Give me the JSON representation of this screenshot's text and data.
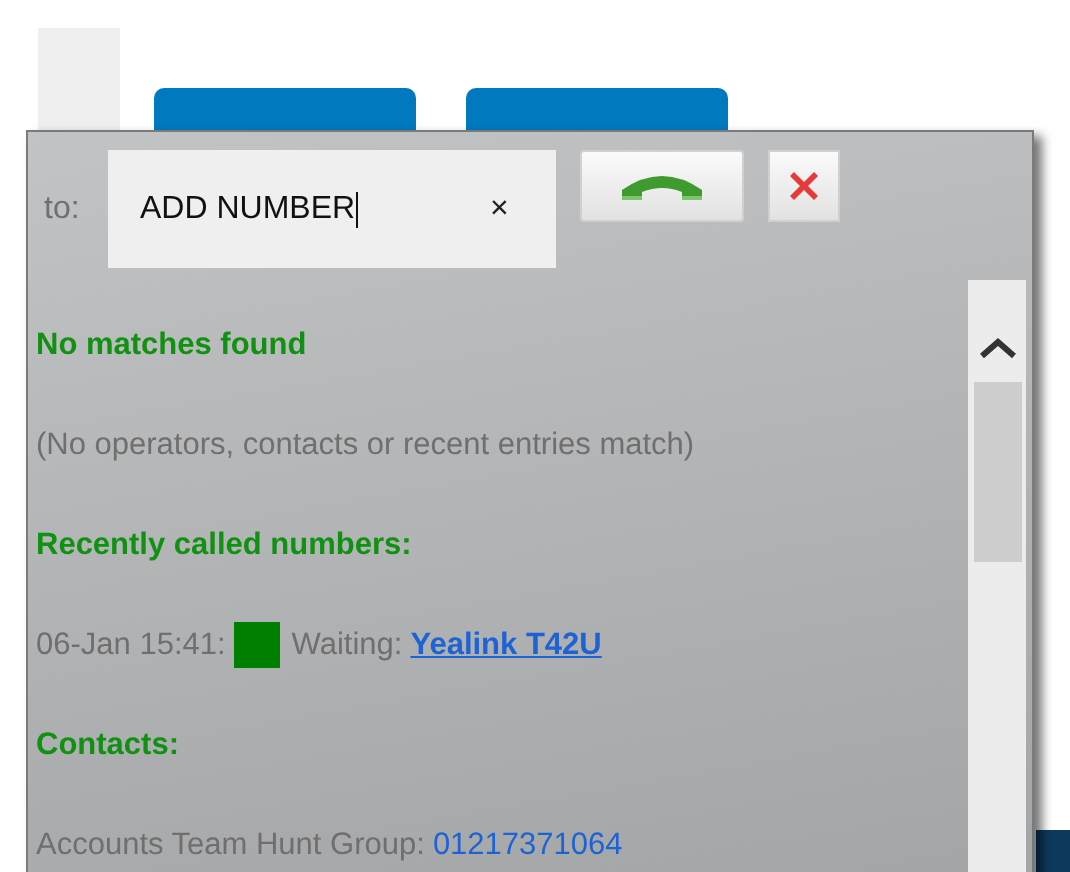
{
  "dialer": {
    "to_label": "to:",
    "number_field": {
      "value": "ADD NUMBER",
      "clear": "×"
    },
    "entries": [
      {
        "kind": "heading",
        "text": "No matches found"
      },
      {
        "kind": "note",
        "text": "(No operators, contacts or recent entries match)"
      },
      {
        "kind": "heading",
        "text": "Recently called numbers:"
      },
      {
        "kind": "recent",
        "time": "06-Jan 15:41:",
        "color": "#008000",
        "status": "Waiting:",
        "link": "Yealink T42U"
      },
      {
        "kind": "heading",
        "text": "Contacts:"
      },
      {
        "kind": "contact",
        "name": "Accounts Team Hunt Group:",
        "number": "01217371064"
      }
    ]
  }
}
